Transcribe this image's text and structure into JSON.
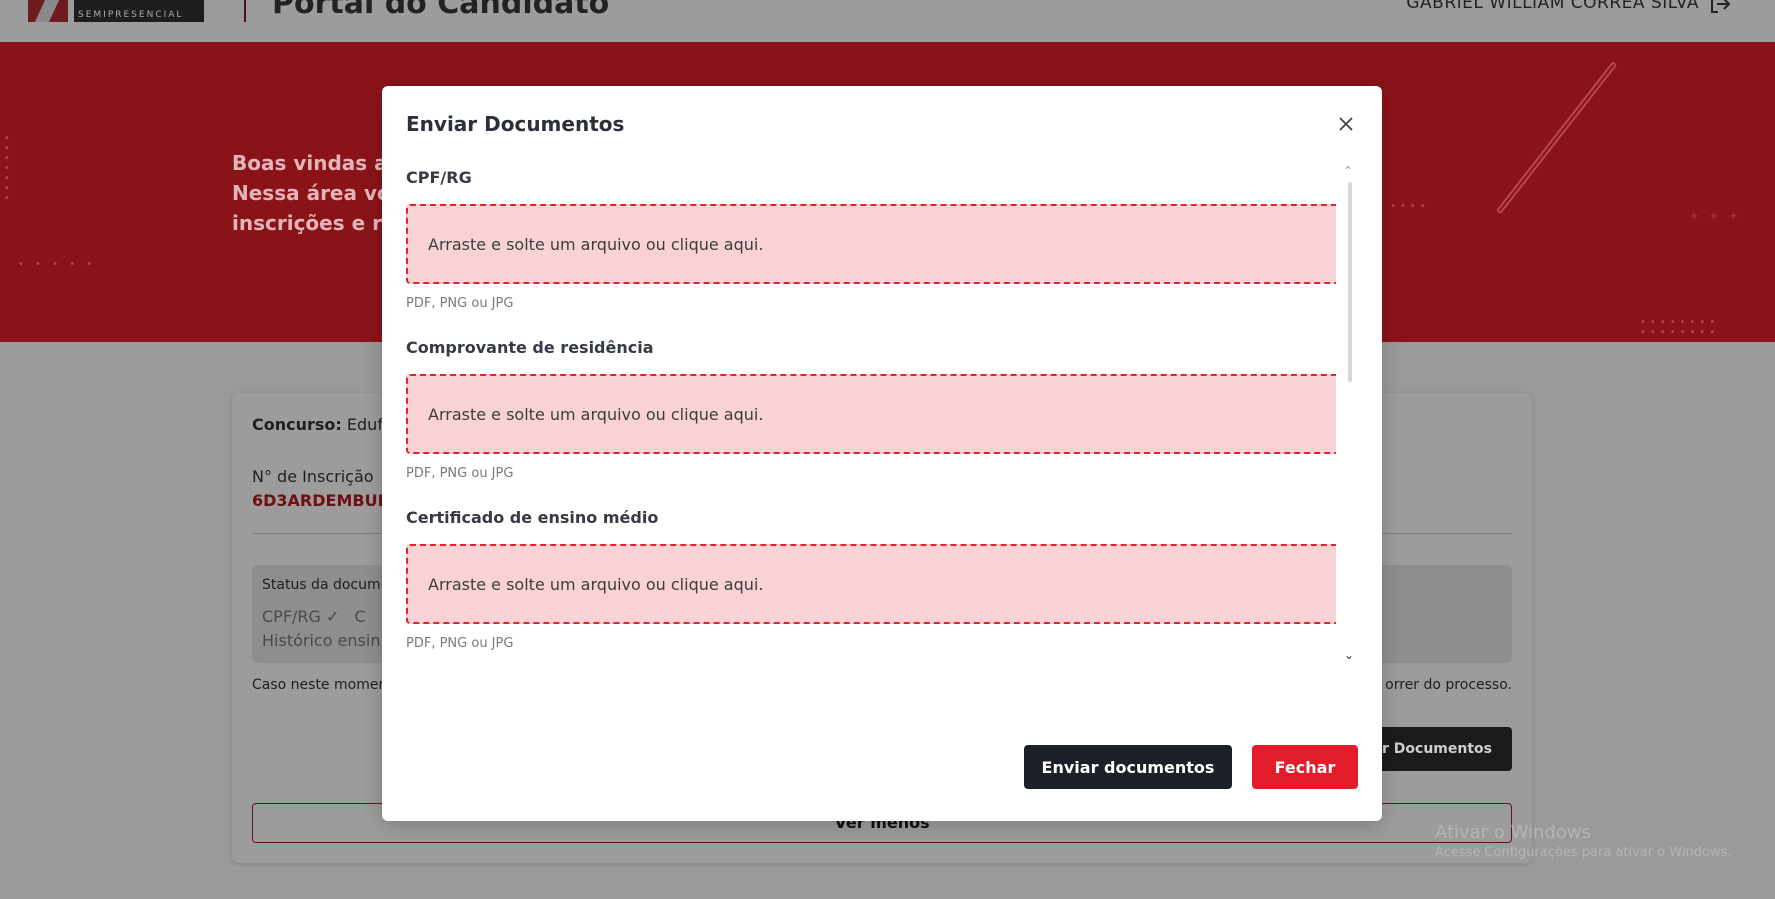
{
  "header": {
    "logo_text": "SEMIPRESENCIAL",
    "portal_title": "Portal do Candidato",
    "user_name": "GABRIEL WILLIAM CORREA SILVA"
  },
  "hero": {
    "line1": "Boas vindas ao",
    "line2": "Nessa área voc",
    "line3": "inscrições e rea"
  },
  "card": {
    "contest_label": "Concurso:",
    "contest_value": "Eduf",
    "inscription_label": "N° de Inscrição",
    "inscription_value": "6D3ARDEMBUL",
    "status_title": "Status da docum",
    "status_item1": "CPF/RG",
    "status_item1_suffix": "C",
    "status_item2": "Histórico ensin",
    "note_left": "Caso neste momen",
    "note_right": "orrer do processo.",
    "send_docs_button": "r Documentos",
    "see_less": "Ver menos"
  },
  "watermark": {
    "title": "Ativar o Windows",
    "subtitle": "Acesse Configurações para ativar o Windows."
  },
  "modal": {
    "title": "Enviar Documentos",
    "fields": [
      {
        "label": "CPF/RG",
        "dropzone_text": "Arraste e solte um arquivo ou clique aqui.",
        "hint": "PDF, PNG ou JPG"
      },
      {
        "label": "Comprovante de residência",
        "dropzone_text": "Arraste e solte um arquivo ou clique aqui.",
        "hint": "PDF, PNG ou JPG"
      },
      {
        "label": "Certificado de ensino médio",
        "dropzone_text": "Arraste e solte um arquivo ou clique aqui.",
        "hint": "PDF, PNG ou JPG"
      }
    ],
    "submit_button": "Enviar documentos",
    "close_button": "Fechar"
  },
  "colors": {
    "accent_red": "#e21c2a",
    "dark_button": "#1e2029",
    "dropzone_bg": "#f8d2d4"
  },
  "icons": [
    "logout-icon",
    "close-icon",
    "check-circle-icon",
    "scroll-up-icon",
    "scroll-down-icon"
  ]
}
